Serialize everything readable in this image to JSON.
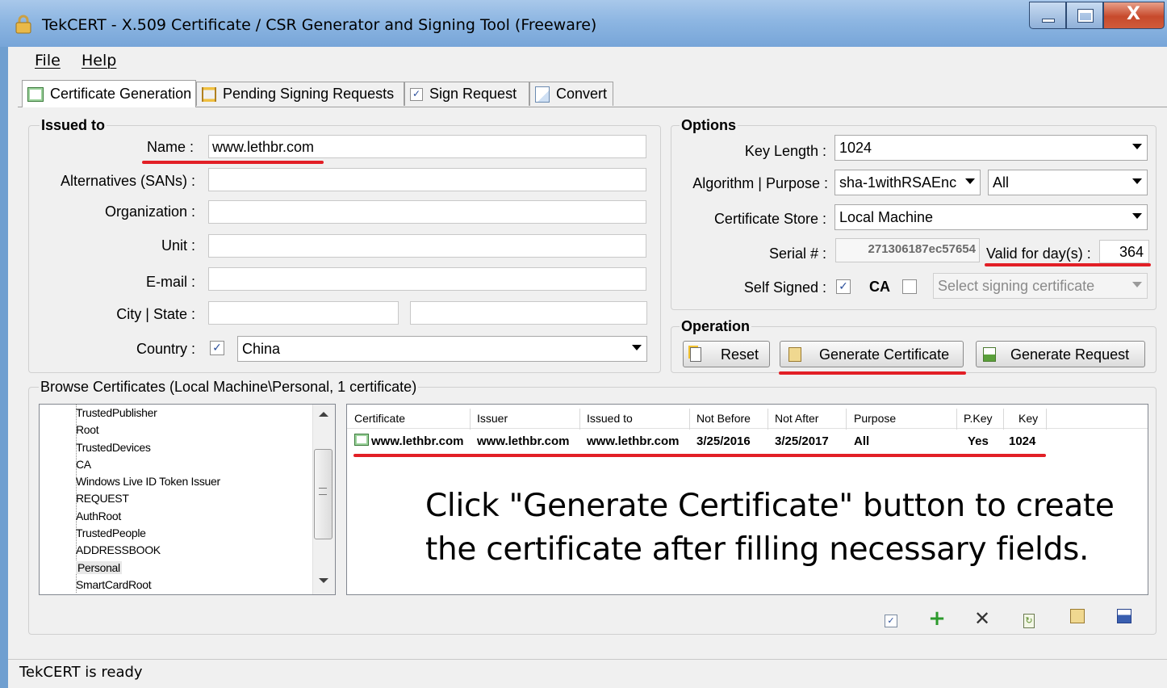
{
  "window": {
    "title": "TekCERT - X.509 Certificate / CSR Generator and Signing Tool (Freeware)",
    "icon": "lock-icon",
    "buttons": [
      "minimize-button",
      "maximize-button",
      "close-button"
    ]
  },
  "menu": {
    "file": "File",
    "help": "Help"
  },
  "tabs": [
    {
      "label": "Certificate Generation",
      "icon": "certificate-icon",
      "active": true
    },
    {
      "label": "Pending Signing Requests",
      "icon": "hourglass-icon",
      "active": false
    },
    {
      "label": "Sign Request",
      "icon": "checkbox-icon",
      "active": false
    },
    {
      "label": "Convert",
      "icon": "convert-icon",
      "active": false
    }
  ],
  "issued_to": {
    "title": "Issued to",
    "name_label": "Name :",
    "name_value": "www.lethbr.com",
    "sans_label": "Alternatives (SANs) :",
    "sans_value": "",
    "org_label": "Organization :",
    "org_value": "",
    "unit_label": "Unit :",
    "unit_value": "",
    "email_label": "E-mail :",
    "email_value": "",
    "city_state_label": "City | State :",
    "city_value": "",
    "state_value": "",
    "country_label": "Country :",
    "country_checked": true,
    "country_value": "China"
  },
  "options": {
    "title": "Options",
    "key_length_label": "Key Length :",
    "key_length_value": "1024",
    "algo_label": "Algorithm | Purpose :",
    "algo_value": "sha-1withRSAEnс",
    "purpose_value": "All",
    "store_label": "Certificate Store :",
    "store_value": "Local Machine",
    "serial_label": "Serial # :",
    "serial_value": "271306187ec57654",
    "valid_label": "Valid for day(s) :",
    "valid_value": "364",
    "self_signed_label": "Self Signed :",
    "self_signed_checked": true,
    "ca_label": "CA",
    "ca_checked": false,
    "signing_cert_placeholder": "Select signing certificate"
  },
  "operation": {
    "title": "Operation",
    "reset": "Reset",
    "generate_cert": "Generate Certificate",
    "generate_request": "Generate Request"
  },
  "browse": {
    "title": "Browse Certificates (Local Machine\\Personal, 1 certificate)",
    "tree": [
      "TrustedPublisher",
      "Root",
      "TrustedDevices",
      "CA",
      "Windows Live ID Token Issuer",
      "REQUEST",
      "AuthRoot",
      "TrustedPeople",
      "ADDRESSBOOK",
      "Personal",
      "SmartCardRoot"
    ],
    "selected": "Personal",
    "columns": [
      "Certificate",
      "Issuer",
      "Issued to",
      "Not Before",
      "Not After",
      "Purpose",
      "P.Key",
      "Key"
    ],
    "rows": [
      [
        "www.lethbr.com",
        "www.lethbr.com",
        "www.lethbr.com",
        "3/25/2016",
        "3/25/2017",
        "All",
        "Yes",
        "1024"
      ]
    ]
  },
  "annotation": {
    "line1": "Click \"Generate Certificate\" button to create",
    "line2": "the certificate after filling necessary fields."
  },
  "toolbar": [
    "check-icon",
    "add-icon",
    "delete-icon",
    "refresh-icon",
    "import-icon",
    "save-icon"
  ],
  "status": {
    "text": "TekCERT is ready"
  },
  "colors": {
    "highlight_underline": "#e21f26",
    "titlebar": "#8db6e2",
    "close_button": "#c74a2c"
  }
}
